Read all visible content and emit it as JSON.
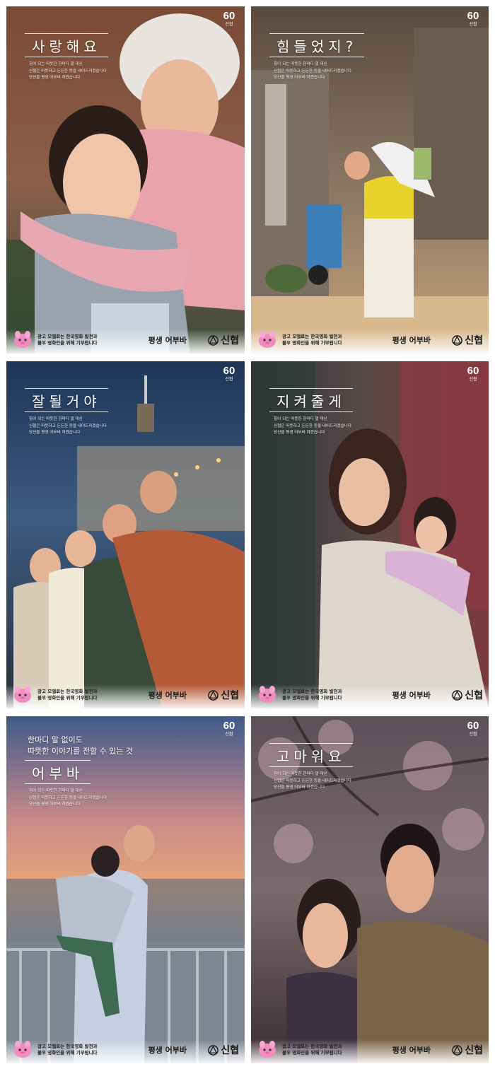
{
  "posters": [
    {
      "title": "사랑해요",
      "body": [
        "힘이 되는 따뜻한 한마디 말 대신",
        "신협은 따뜻하고 든든한 등을 내어드리겠습니다",
        "당신을 평생 어부바 하겠습니다"
      ]
    },
    {
      "title": "힘들었지?",
      "body": [
        "힘이 되는 따뜻한 한마디 말 대신",
        "신협은 따뜻하고 든든한 등을 내어드리겠습니다",
        "당신을 평생 어부바 하겠습니다"
      ]
    },
    {
      "title": "잘될거야",
      "body": [
        "힘이 되는 따뜻한 한마디 말 대신",
        "신협은 따뜻하고 든든한 등을 내어드리겠습니다",
        "당신을 평생 어부바 하겠습니다"
      ]
    },
    {
      "title": "지켜줄게",
      "body": [
        "힘이 되는 따뜻한 한마디 말 대신",
        "신협은 따뜻하고 든든한 등을 내어드리겠습니다",
        "당신을 평생 어부바 하겠습니다"
      ]
    },
    {
      "pre": [
        "한마디 말 없이도",
        "따뜻한 이야기를 전할 수 있는 것"
      ],
      "title": "어부바",
      "body": [
        "힘이 되는 따뜻한 한마디 말 대신",
        "신협은 따뜻하고 든든한 등을 내어드리겠습니다",
        "당신을 평생 어부바 하겠습니다"
      ]
    },
    {
      "title": "고마워요",
      "body": [
        "힘이 되는 따뜻한 한마디 말 대신",
        "신협은 따뜻하고 든든한 등을 내어드리겠습니다",
        "당신을 평생 어부바 하겠습니다"
      ]
    }
  ],
  "badge": {
    "number": "60",
    "label": "신협"
  },
  "footer": {
    "donation_line1": "광고 모델료는 한국영화 발전과",
    "donation_line2": "불우 영화인을 위해 기부됩니다",
    "slogan": "평생 어부바",
    "brand": "신협"
  },
  "icons": [
    "mascot-icon",
    "shinhyup-logo-icon"
  ]
}
